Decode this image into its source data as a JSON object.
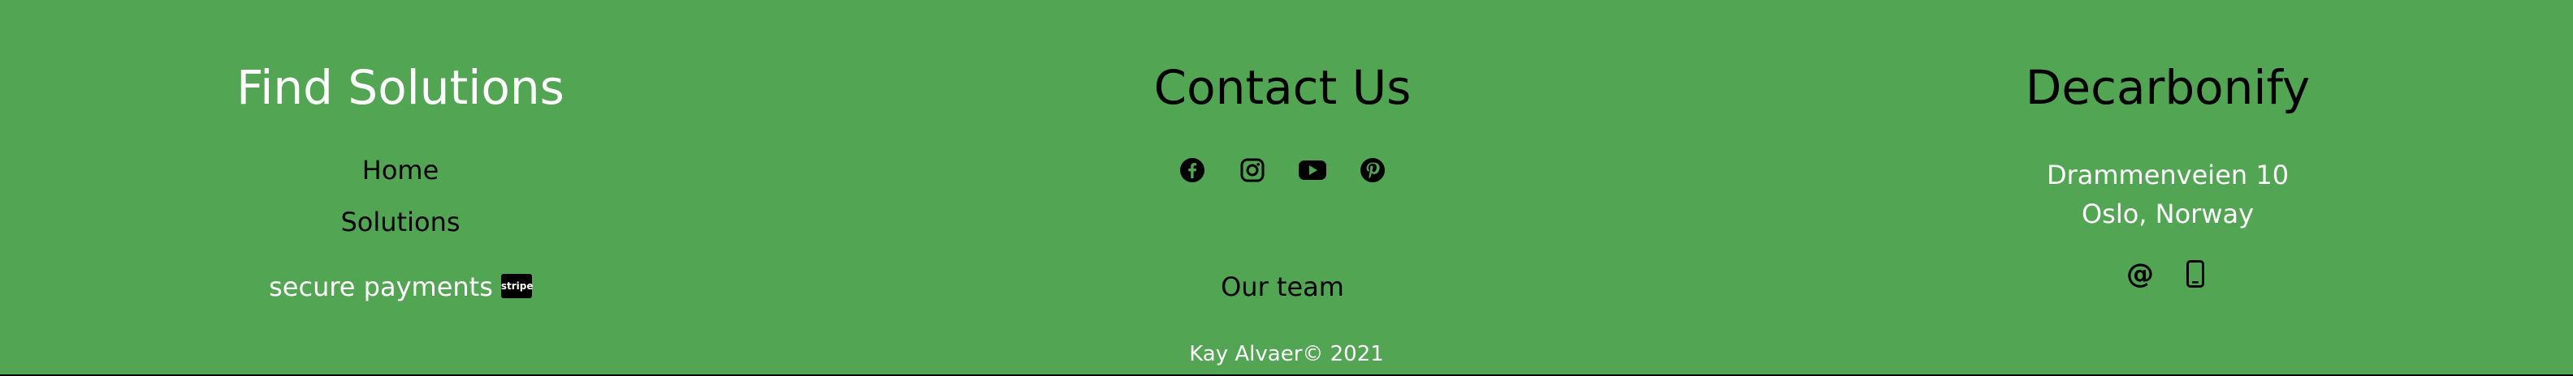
{
  "colors": {
    "background": "#52a552",
    "text_dark": "#000000",
    "text_light": "#ffffff"
  },
  "find_solutions": {
    "heading": "Find Solutions",
    "links": [
      {
        "label": "Home"
      },
      {
        "label": "Solutions"
      }
    ],
    "payments_label": "secure payments",
    "payments_badge": "stripe"
  },
  "contact": {
    "heading": "Contact Us",
    "social_icons": [
      "facebook-icon",
      "instagram-icon",
      "youtube-icon",
      "pinterest-icon"
    ],
    "team_link": "Our team"
  },
  "decarbonify": {
    "heading": "Decarbonify",
    "address_line1": "Drammenveien 10",
    "address_line2": "Oslo, Norway",
    "email_glyph": "@",
    "contact_icons": [
      "email-at-icon",
      "mobile-phone-icon"
    ]
  },
  "copyright": "Kay Alvaer© 2021"
}
